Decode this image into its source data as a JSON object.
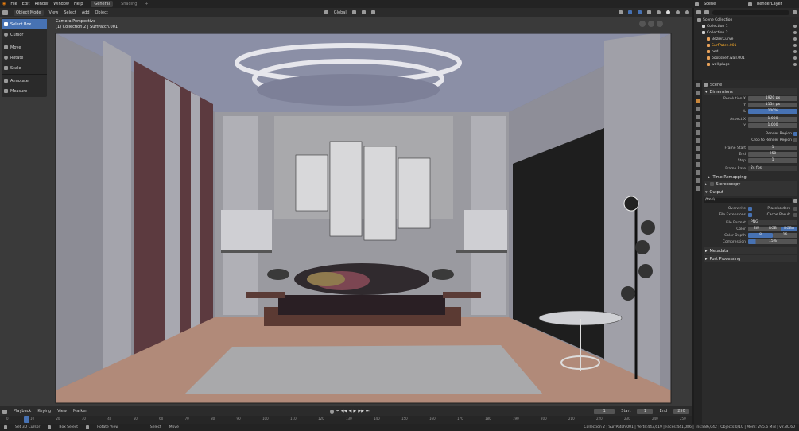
{
  "topbar": {
    "menus": [
      "File",
      "Edit",
      "Render",
      "Window",
      "Help"
    ],
    "workspace_tabs": [
      "General",
      "Shading"
    ],
    "scene_label": "Scene",
    "view_layer_label": "RenderLayer"
  },
  "viewport_header": {
    "mode": "Object Mode",
    "menus": [
      "View",
      "Select",
      "Add",
      "Object"
    ],
    "transform_orientation": "Global"
  },
  "toolbar": {
    "tools": [
      "Select Box",
      "Cursor",
      "Move",
      "Rotate",
      "Scale",
      "Annotate",
      "Measure"
    ]
  },
  "viewport_overlay": {
    "camera_title": "Camera Perspective",
    "camera_subtitle": "(1) Collection 2 | SurfPatch.001"
  },
  "outliner": {
    "root": "Scene Collection",
    "items": [
      {
        "label": "Collection 1",
        "indent": 1
      },
      {
        "label": "Collection 2",
        "indent": 1
      },
      {
        "label": "BezierCurve",
        "indent": 2
      },
      {
        "label": "SurfPatch.001",
        "indent": 2
      },
      {
        "label": "bed",
        "indent": 2
      },
      {
        "label": "bookshelf.wall.001",
        "indent": 2
      },
      {
        "label": "wall plugs",
        "indent": 2
      }
    ]
  },
  "properties": {
    "scene_label": "Scene",
    "dimensions": {
      "title": "Dimensions",
      "resolution_x_label": "Resolution X",
      "resolution_x": "1920 px",
      "resolution_y_label": "Y",
      "resolution_y": "1154 px",
      "percent_label": "%",
      "percent": "100%",
      "aspect_x_label": "Aspect X",
      "aspect_x": "1.000",
      "aspect_y_label": "Y",
      "aspect_y": "1.000",
      "render_region_label": "Render Region",
      "crop_label": "Crop to Render Region",
      "frame_start_label": "Frame Start",
      "frame_start": "1",
      "end_label": "End",
      "end": "250",
      "step_label": "Step",
      "step": "1",
      "frame_rate_label": "Frame Rate",
      "frame_rate": "24 fps"
    },
    "time_remapping": "Time Remapping",
    "stereoscopy": "Stereoscopy",
    "output": {
      "title": "Output",
      "path": "/tmp\\",
      "overwrite_label": "Overwrite",
      "placeholders_label": "Placeholders",
      "file_extensions_label": "File Extensions",
      "cache_result_label": "Cache Result",
      "file_format_label": "File Format",
      "file_format": "PNG",
      "color_label": "Color",
      "color_options": [
        "BW",
        "RGB",
        "RGBA"
      ],
      "color_depth_label": "Color Depth",
      "color_depth_options": [
        "8",
        "16"
      ],
      "compression_label": "Compression",
      "compression": "15%"
    },
    "metadata": "Metadata",
    "post_processing": "Post Processing"
  },
  "timeline": {
    "menus": [
      "Playback",
      "Keying",
      "View",
      "Marker"
    ],
    "current_frame": "1",
    "start_label": "Start",
    "start": "1",
    "end_label": "End",
    "end": "250",
    "ticks": [
      "0",
      "10",
      "20",
      "30",
      "40",
      "50",
      "60",
      "70",
      "80",
      "90",
      "100",
      "110",
      "120",
      "130",
      "140",
      "150",
      "160",
      "170",
      "180",
      "190",
      "200",
      "210",
      "220",
      "230",
      "240",
      "250"
    ]
  },
  "statusbar": {
    "left_items": [
      "Set 3D Cursor",
      "Box Select",
      "Rotate View",
      "Select",
      "Move"
    ],
    "stats": "Collection 2 | SurfPatch.001 | Verts:443,619 | Faces:441,086 | Tris:886,042 | Objects:0/10 | Mem: 295.6 MiB | v2.80.60"
  },
  "colors": {
    "accent": "#4772b3",
    "active_object": "#c9873b"
  }
}
